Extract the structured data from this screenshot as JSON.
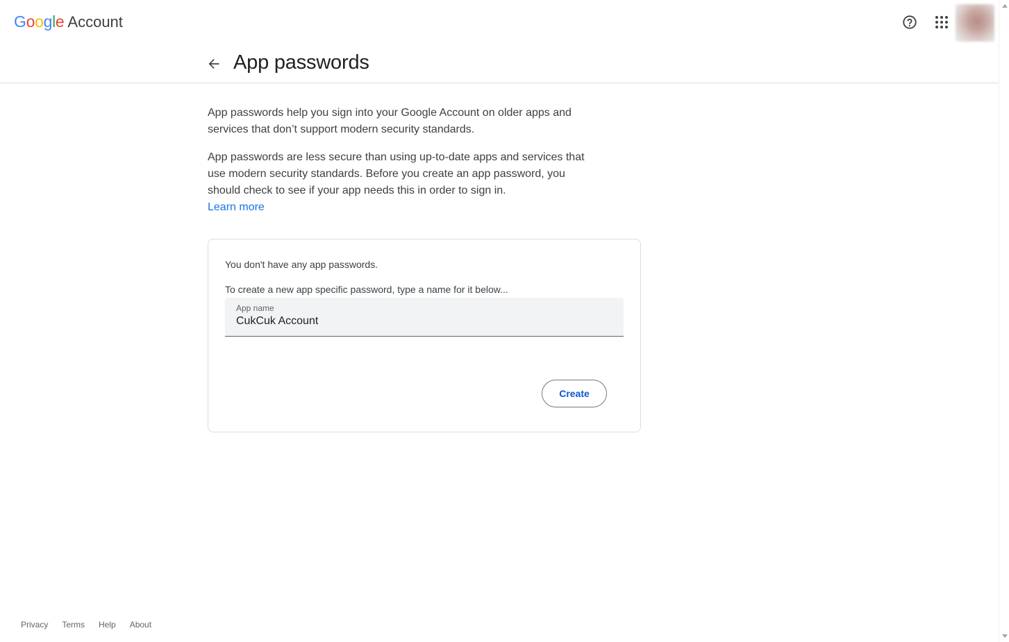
{
  "header": {
    "logo_letters": [
      "G",
      "o",
      "o",
      "g",
      "l",
      "e"
    ],
    "logo_colors": [
      "#4285f4",
      "#ea4335",
      "#fbbc05",
      "#4285f4",
      "#34a853",
      "#ea4335"
    ],
    "logo_suffix": "Account",
    "icons": [
      "help-icon",
      "apps-grid-icon"
    ]
  },
  "title": "App passwords",
  "intro": {
    "paragraph1": "App passwords help you sign into your Google Account on older apps and services that don’t support modern security standards.",
    "paragraph2": "App passwords are less secure than using up-to-date apps and services that use modern security standards. Before you create an app password, you should check to see if your app needs this in order to sign in.",
    "learn_more": "Learn more"
  },
  "card": {
    "empty_message": "You don't have any app passwords.",
    "create_hint": "To create a new app specific password, type a name for it below...",
    "field_label": "App name",
    "field_value": "CukCuk Account",
    "create_button": "Create"
  },
  "footer": {
    "links": [
      "Privacy",
      "Terms",
      "Help",
      "About"
    ]
  },
  "colors": {
    "accent": "#1a73e8",
    "button_text": "#0b57d0",
    "divider": "#dadce0"
  }
}
